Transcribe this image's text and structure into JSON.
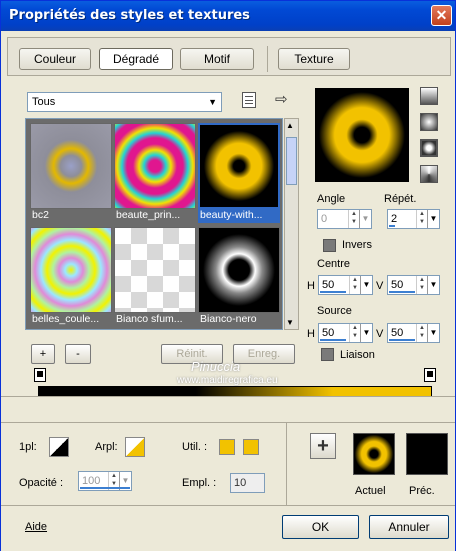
{
  "window": {
    "title": "Propriétés des styles et textures",
    "close": "✕"
  },
  "tabs": [
    "Couleur",
    "Dégradé",
    "Motif",
    "Texture"
  ],
  "filter": {
    "value": "Tous"
  },
  "gradients": [
    {
      "label": "bc2"
    },
    {
      "label": "beaute_prin..."
    },
    {
      "label": "beauty-with..."
    },
    {
      "label": "belles_coule..."
    },
    {
      "label": "Bianco sfum..."
    },
    {
      "label": "Bianco-nero"
    }
  ],
  "buttons": {
    "add": "+",
    "remove": "-",
    "reset": "Réinit.",
    "save": "Enreg.",
    "ok": "OK",
    "cancel": "Annuler",
    "help": "Aide"
  },
  "angle": {
    "label": "Angle",
    "value": "0"
  },
  "repeat": {
    "label": "Répét.",
    "value": "2"
  },
  "invert": {
    "label": "Invers"
  },
  "center": {
    "label": "Centre",
    "h_label": "H",
    "h": "50",
    "v_label": "V",
    "v": "50"
  },
  "source": {
    "label": "Source",
    "h_label": "H",
    "h": "50",
    "v_label": "V",
    "v": "50"
  },
  "link": {
    "label": "Liaison"
  },
  "watermark": {
    "line1": "Pinuccia",
    "line2": "www.maidiregrafica.eu"
  },
  "colors": {
    "black": "#000000",
    "gold": "#f2c200",
    "gray": "#8e8e9a",
    "pink": "#e0168f",
    "cyan": "#22d4d4"
  },
  "bottom": {
    "pl_label": "1pl:",
    "arpl_label": "Arpl:",
    "util_label": "Util. :",
    "opacity_label": "Opacité :",
    "opacity_value": "100",
    "empl_label": "Empl. :",
    "empl_value": "10",
    "current_label": "Actuel",
    "previous_label": "Préc."
  }
}
